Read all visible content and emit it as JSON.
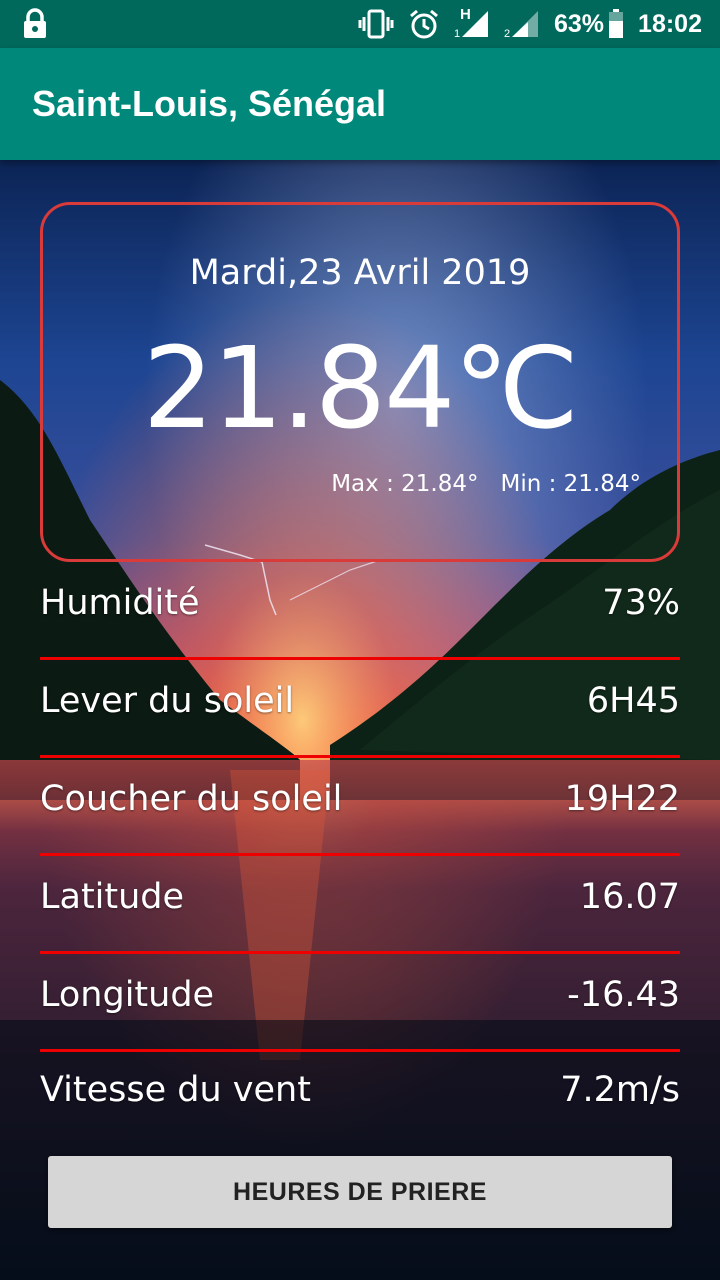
{
  "status_bar": {
    "battery": "63%",
    "time": "18:02",
    "icons": [
      "lock-icon",
      "vibrate-icon",
      "alarm-icon",
      "signal-h-sim1-icon",
      "signal-sim2-icon",
      "battery-icon"
    ],
    "sim1_network": "H",
    "sim1_index": "1",
    "sim2_index": "2"
  },
  "app_bar": {
    "title": "Saint-Louis, Sénégal",
    "color": "#00897b"
  },
  "weather": {
    "date": "Mardi,23 Avril 2019",
    "temperature": "21.84℃",
    "max": "Max : 21.84°",
    "min": "Min : 21.84°"
  },
  "details": [
    {
      "label": "Humidité",
      "value": "73%"
    },
    {
      "label": "Lever du soleil",
      "value": "6H45"
    },
    {
      "label": "Coucher du soleil",
      "value": "19H22"
    },
    {
      "label": "Latitude",
      "value": "16.07"
    },
    {
      "label": "Longitude",
      "value": "-16.43"
    },
    {
      "label": "Vitesse du vent",
      "value": "7.2m/s"
    }
  ],
  "button": {
    "label": "HEURES DE PRIERE"
  },
  "colors": {
    "status_bar": "#00695c",
    "card_border": "#d93a3a",
    "divider": "#ee0000",
    "button": "#d6d6d6"
  }
}
